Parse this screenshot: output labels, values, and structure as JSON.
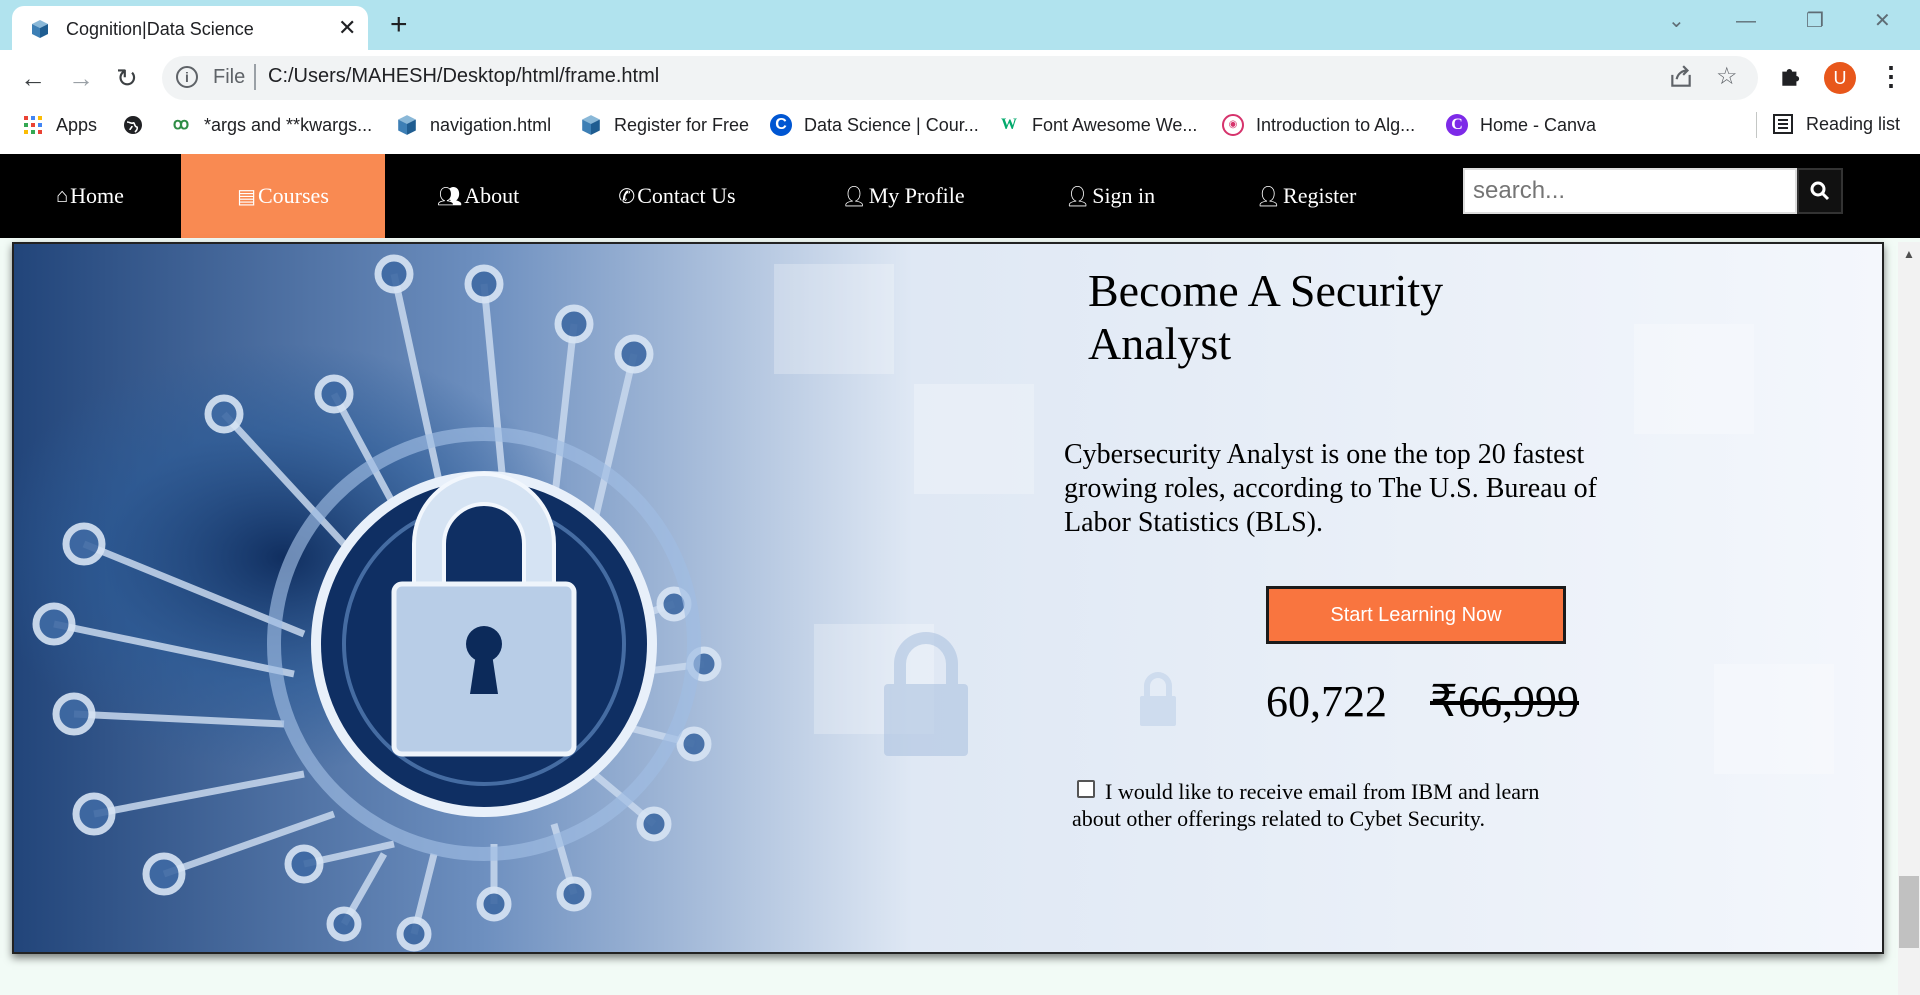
{
  "browser": {
    "tab_title": "Cognition|Data Science",
    "tab_close": "✕",
    "new_tab": "+",
    "window_controls": [
      "⌄",
      "—",
      "❐",
      "✕"
    ],
    "nav": {
      "back": "←",
      "forward": "→",
      "reload": "↻"
    },
    "omnibox": {
      "scheme_label": "File",
      "url": "C:/Users/MAHESH/Desktop/html/frame.html",
      "info": "i"
    },
    "avatar_letter": "U",
    "menu": "⋮",
    "bookmarks": [
      {
        "label": "Apps",
        "icon": "apps-grid-icon"
      },
      {
        "label": "",
        "icon": "globe-icon"
      },
      {
        "label": "*args and **kwargs...",
        "icon": "geeksforgeeks-icon"
      },
      {
        "label": "navigation.html",
        "icon": "file-cube-icon"
      },
      {
        "label": "Register for Free",
        "icon": "file-cube-icon"
      },
      {
        "label": "Data Science | Cour...",
        "icon": "coursera-icon"
      },
      {
        "label": "Font Awesome We...",
        "icon": "w3schools-icon"
      },
      {
        "label": "Introduction to Alg...",
        "icon": "site-icon"
      },
      {
        "label": "Home - Canva",
        "icon": "canva-icon"
      }
    ],
    "reading_list": "Reading list"
  },
  "site_nav": {
    "items": [
      {
        "label": "Home",
        "icon": "home-icon"
      },
      {
        "label": "Courses",
        "icon": "book-icon",
        "active": true
      },
      {
        "label": "About",
        "icon": "users-icon"
      },
      {
        "label": "Contact Us",
        "icon": "phone-icon"
      },
      {
        "label": "My Profile",
        "icon": "user-icon"
      },
      {
        "label": "Sign in",
        "icon": "user-plus-icon"
      },
      {
        "label": "Register",
        "icon": "user-icon"
      }
    ],
    "search_placeholder": "search...",
    "active_color": "#f98a52"
  },
  "hero": {
    "title": "Become A Security Analyst",
    "description": "Cybersecurity Analyst is one the top 20 fastest growing roles, according to The U.S. Bureau of Labor Statistics (BLS).",
    "cta_label": "Start Learning Now",
    "cta_color": "#f9753f",
    "price_current": "60,722",
    "price_original": "₹66,999",
    "consent_label": "I would like to receive email from IBM and learn about other offerings related to Cybet Security.",
    "consent_checked": false
  }
}
